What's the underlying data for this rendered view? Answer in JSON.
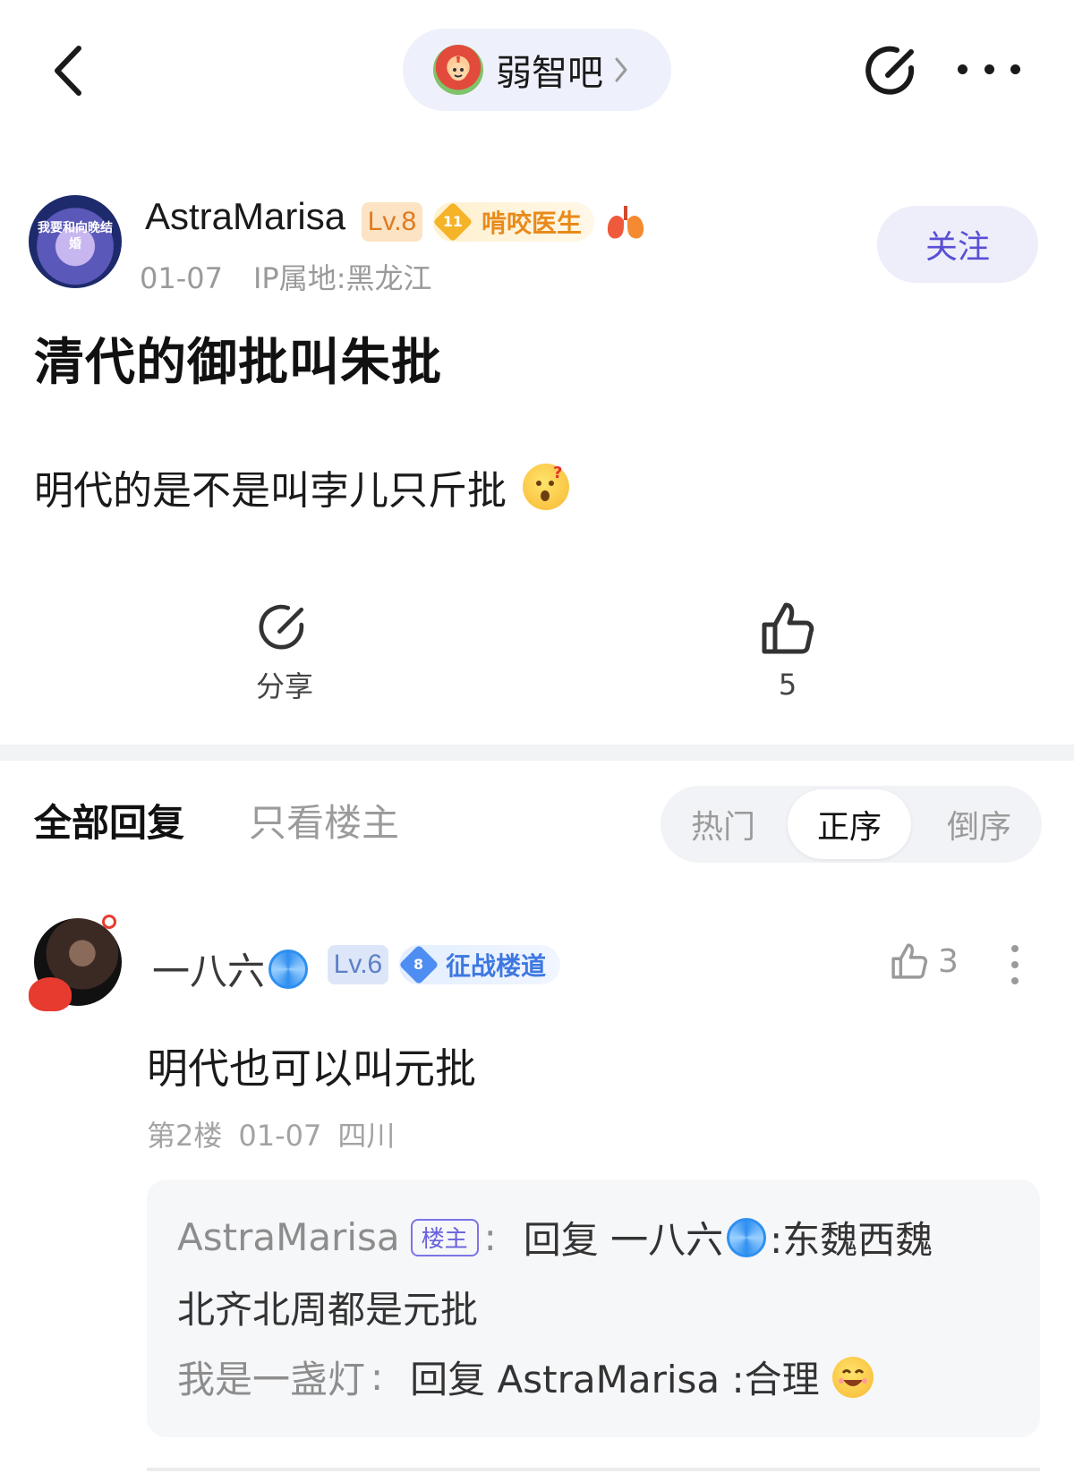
{
  "header": {
    "forum_name": "弱智吧"
  },
  "post": {
    "author": "AstraMarisa",
    "avatar_text": "我要和向晚结婚",
    "level": "Lv.8",
    "medal_num": "11",
    "medal_label": "啃咬医生",
    "date": "01-07",
    "ip": "IP属地:黑龙江",
    "follow_label": "关注",
    "title": "清代的御批叫朱批",
    "body": "明代的是不是叫孛儿只斤批"
  },
  "actions": {
    "share_label": "分享",
    "like_count": "5"
  },
  "replies_header": {
    "tab_all": "全部回复",
    "tab_op": "只看楼主",
    "sort": [
      "热门",
      "正序",
      "倒序"
    ],
    "sort_selected": "正序"
  },
  "comment": {
    "author": "一八六",
    "level": "Lv.6",
    "medal_num": "8",
    "medal_label": "征战楼道",
    "like_count": "3",
    "text": "明代也可以叫元批",
    "floor": "第2楼",
    "date": "01-07",
    "location": "四川",
    "sub_replies": [
      {
        "author": "AstraMarisa",
        "tag": "楼主",
        "colon": ":",
        "reply_prefix": "回复 一八六",
        "content_line1": ":东魏西魏",
        "content_line2": "北齐北周都是元批"
      },
      {
        "author": "我是一盏灯",
        "colon": ":",
        "content": "回复 AstraMarisa :合理"
      }
    ]
  },
  "colors": {
    "accent": "#5a4fd4",
    "level8": "#e07a1f",
    "level6": "#5d7fc8",
    "medal_gold": "#f5b328",
    "medal_blue": "#4e8df2"
  }
}
